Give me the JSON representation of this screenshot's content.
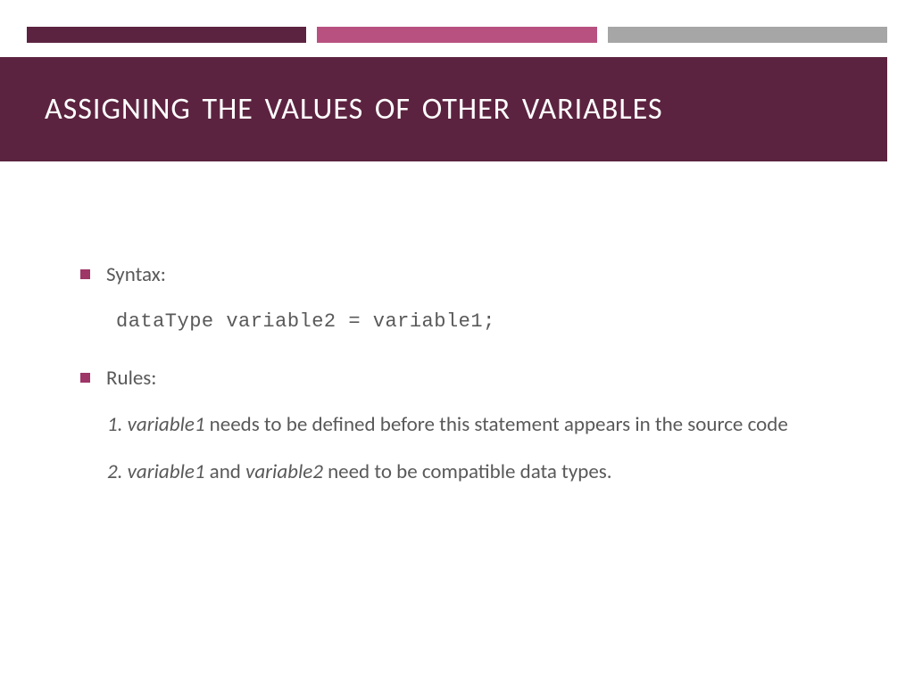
{
  "title": "ASSIGNING THE VALUES OF OTHER VARIABLES",
  "syntax_label": "Syntax:",
  "syntax_code": "dataType variable2 = variable1;",
  "rules_label": "Rules:",
  "rule1_num": "1. ",
  "rule1_var": "variable1",
  "rule1_rest": " needs to be defined before this statement appears in the source code",
  "rule2_num": "2. ",
  "rule2_var1": "variable1",
  "rule2_mid": " and ",
  "rule2_var2": "variable2",
  "rule2_rest": " need to be compatible data types."
}
